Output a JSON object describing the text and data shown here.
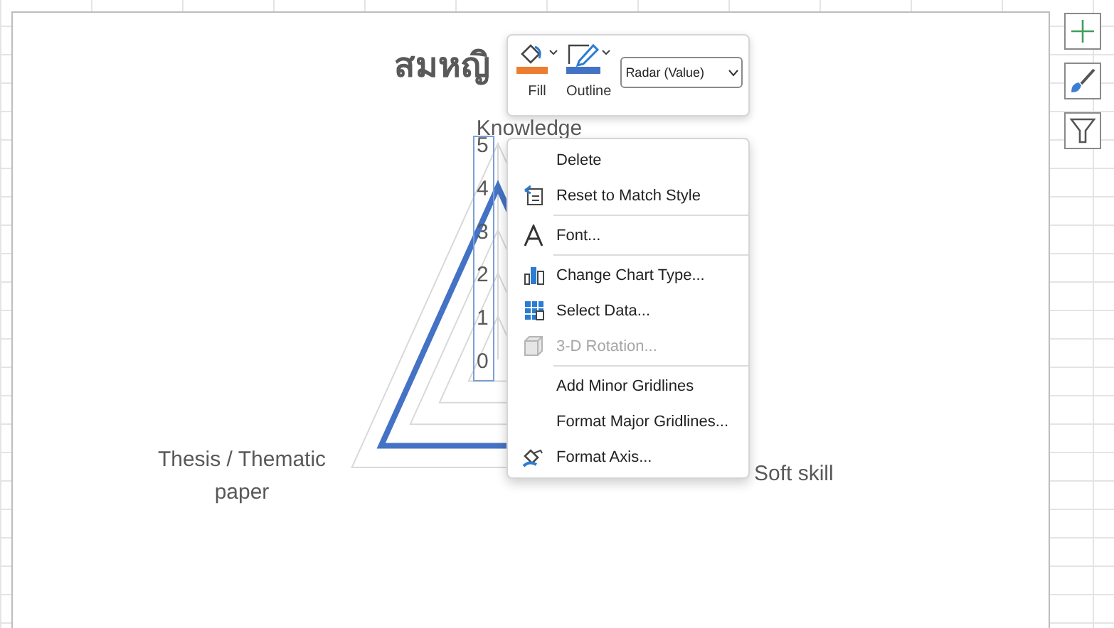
{
  "chart": {
    "title": "สมหญิ",
    "axis_labels": [
      "Knowledge",
      "Soft skill",
      "Thesis / Thematic paper"
    ],
    "tick_labels": [
      "5",
      "4",
      "3",
      "2",
      "1",
      "0"
    ]
  },
  "toolbar": {
    "buttons": [
      {
        "label": "Fill",
        "color": "#ed7d31"
      },
      {
        "label": "Outline",
        "color": "#4472c4"
      }
    ],
    "element_select": {
      "value": "Radar (Value)"
    }
  },
  "context_menu": {
    "items": [
      {
        "kind": "item",
        "label": "Delete",
        "disabled": false
      },
      {
        "kind": "item",
        "label": "Reset to Match Style",
        "disabled": false
      },
      {
        "kind": "separator"
      },
      {
        "kind": "item",
        "label": "Font...",
        "disabled": false
      },
      {
        "kind": "separator"
      },
      {
        "kind": "item",
        "label": "Change Chart Type...",
        "disabled": false
      },
      {
        "kind": "item",
        "label": "Select Data...",
        "disabled": false
      },
      {
        "kind": "item",
        "label": "3-D Rotation...",
        "disabled": true
      },
      {
        "kind": "separator"
      },
      {
        "kind": "item",
        "label": "Add Minor Gridlines",
        "disabled": false
      },
      {
        "kind": "item",
        "label": "Format Major Gridlines...",
        "disabled": false
      },
      {
        "kind": "item",
        "label": "Format Axis...",
        "disabled": false
      }
    ]
  }
}
